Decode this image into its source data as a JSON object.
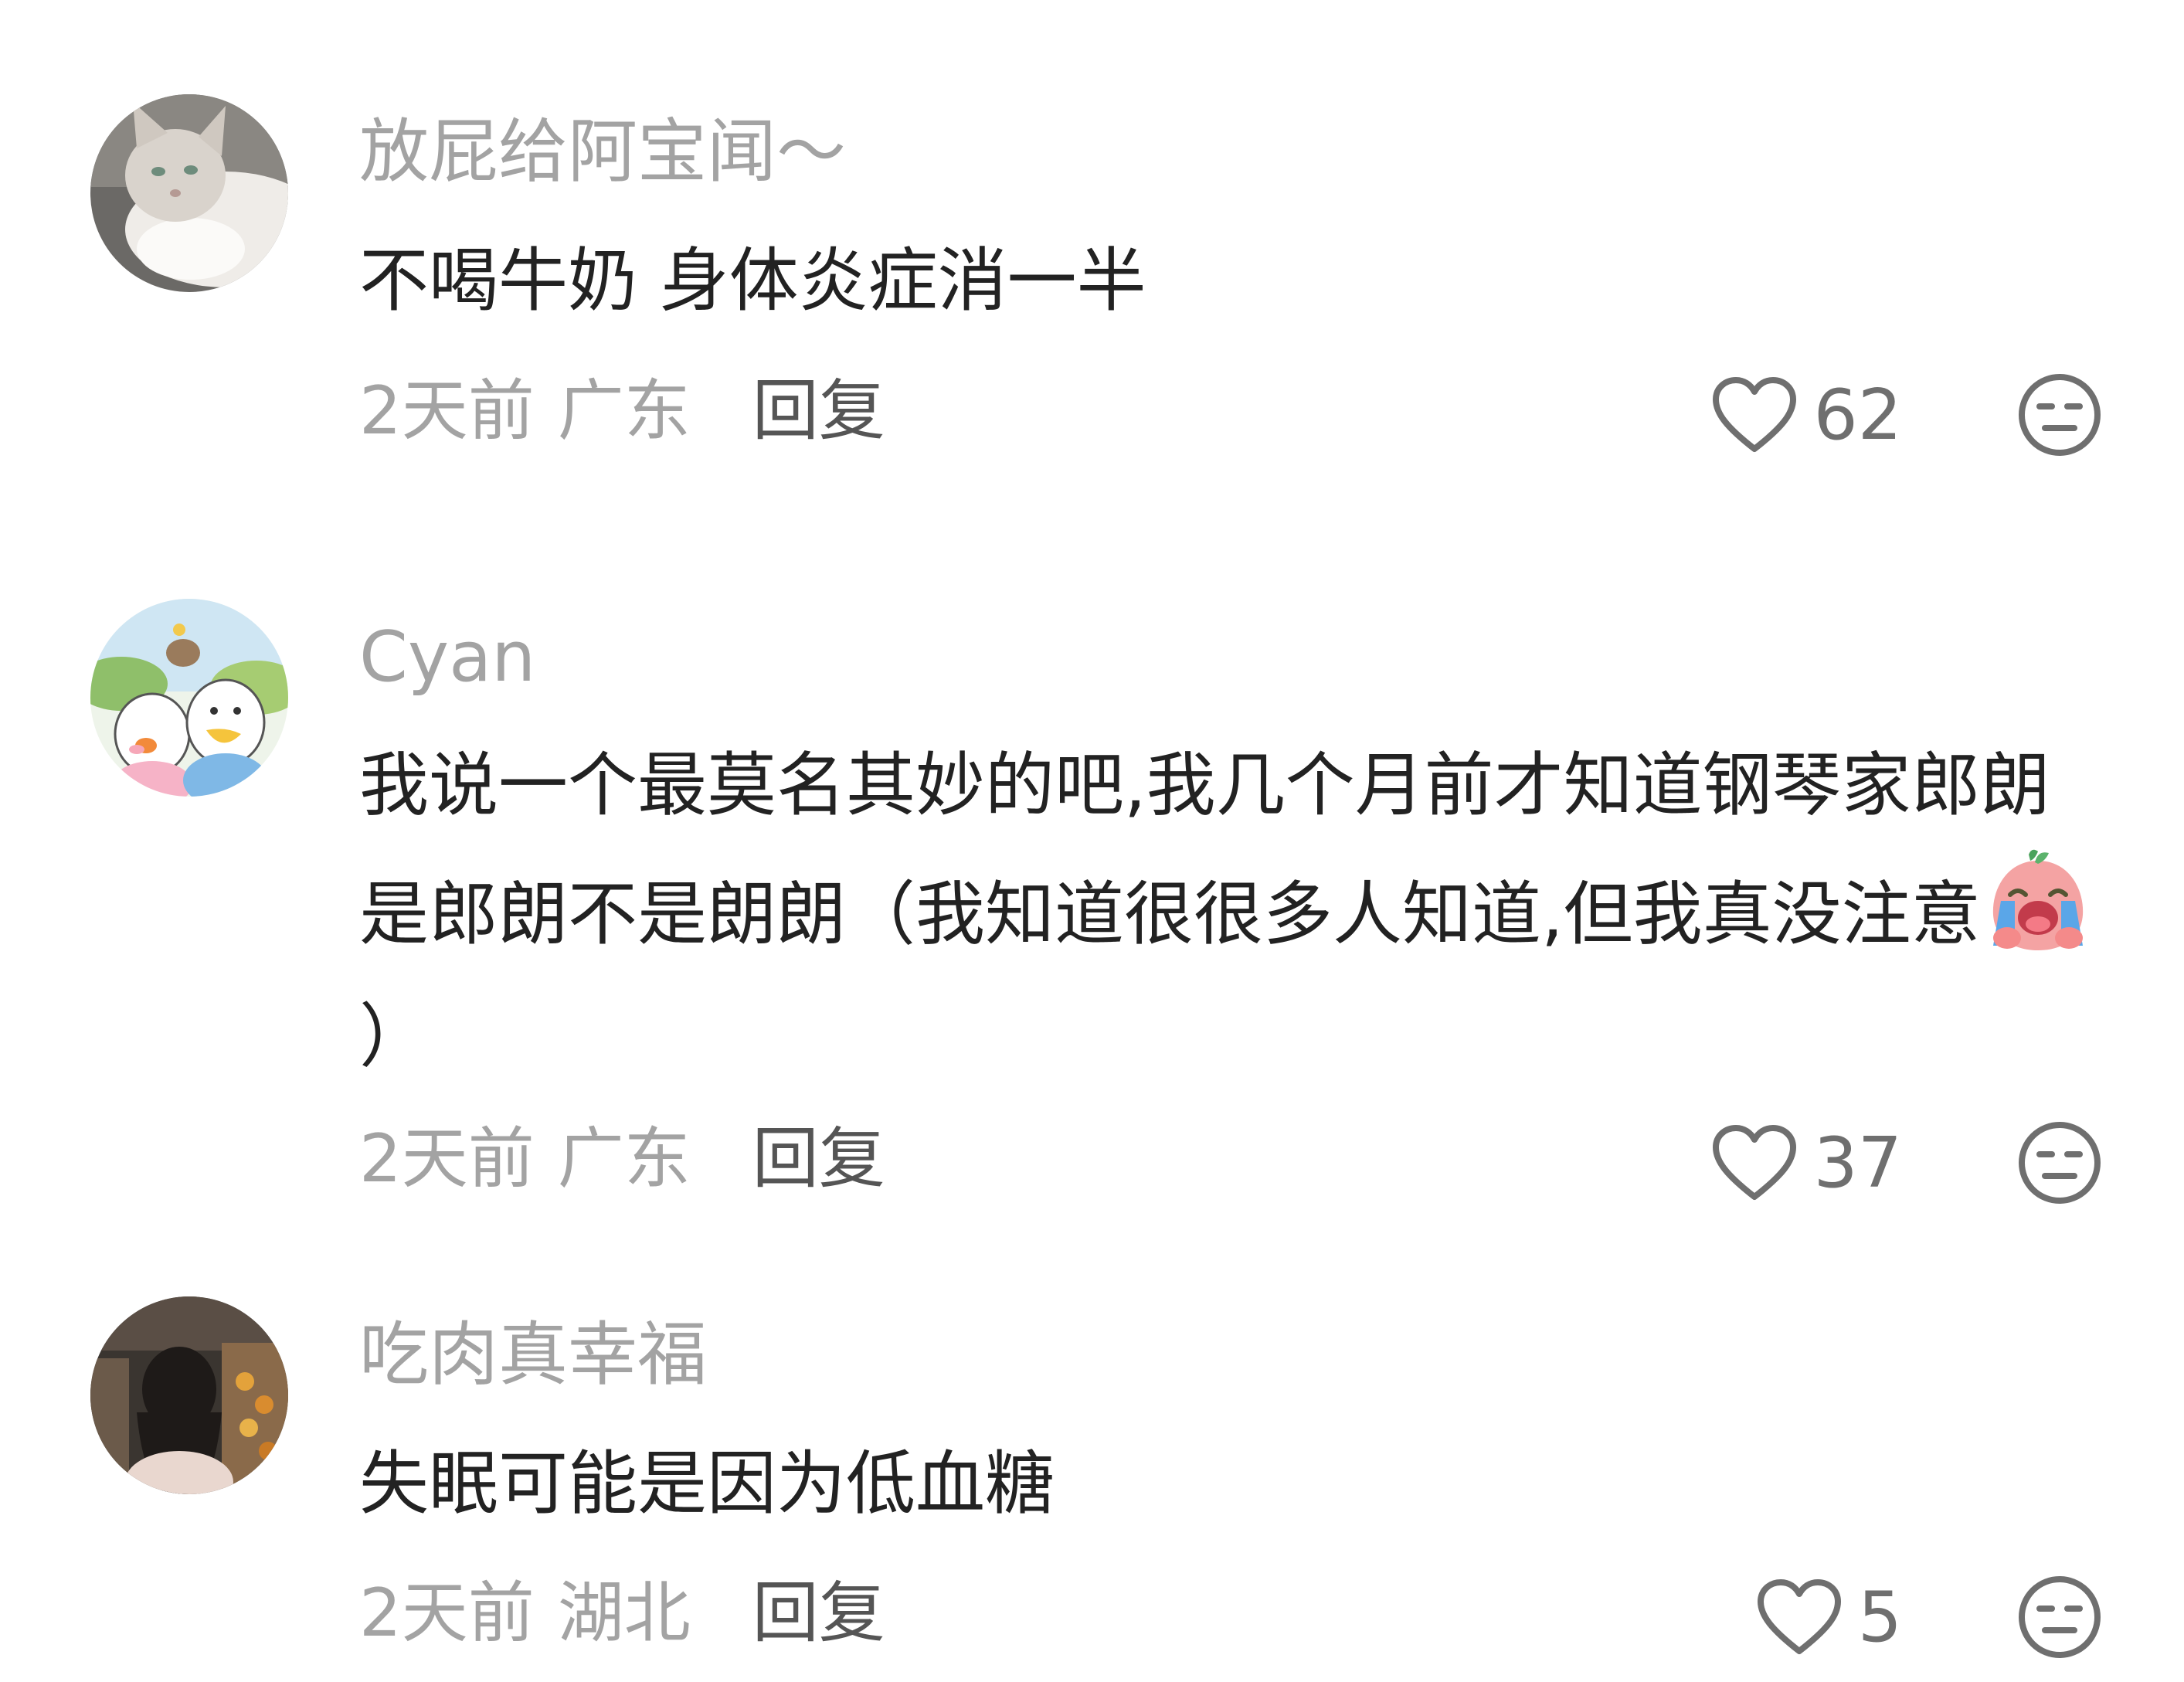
{
  "comments": [
    {
      "username": "放屁给阿宝闻～",
      "text": "不喝牛奶 身体炎症消一半",
      "time": "2天前",
      "location": "广东",
      "reply_label": "回复",
      "likes": "62",
      "avatar_icon": "cat-avatar"
    },
    {
      "username": "Cyan",
      "text": "我说一个最莫名其妙的吧,我几个月前才知道钢琴家郎朗是郎朗不是朗朗（我知道很很多人知道,但我真没注意",
      "text_end": "）",
      "time": "2天前",
      "location": "广东",
      "reply_label": "回复",
      "likes": "37",
      "avatar_icon": "cartoon-ducks-avatar",
      "emoji_icon": "crying-face-emoji"
    },
    {
      "username": "吃肉真幸福",
      "text": "失眠可能是因为低血糖",
      "time": "2天前",
      "location": "湖北",
      "reply_label": "回复",
      "likes": "5",
      "avatar_icon": "photo-person-avatar"
    }
  ],
  "colors": {
    "username": "#a3a3a3",
    "text": "#222222",
    "meta": "#a3a3a3",
    "reply": "#555555",
    "icon": "#6f6f6f"
  }
}
